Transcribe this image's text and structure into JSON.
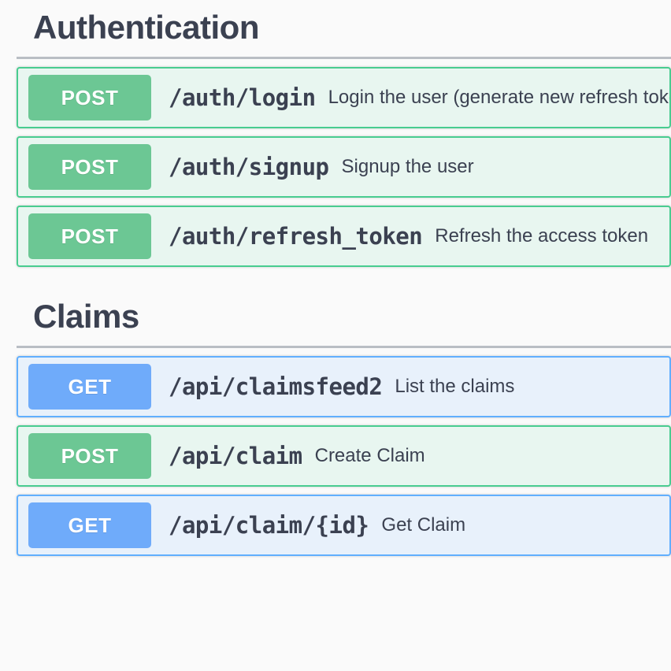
{
  "page": {
    "background": "#fafafa",
    "text_color": "#3b4151"
  },
  "colors": {
    "post_badge": "#6cc794",
    "post_row_bg": "#e8f6f0",
    "post_row_border": "#49cc90",
    "get_badge": "#6fabfa",
    "get_row_bg": "#e8f1fb",
    "get_row_border": "#61affe",
    "rule": "#b9bec4",
    "heading": "#3b4151"
  },
  "sections": [
    {
      "title": "Authentication",
      "operations": [
        {
          "method": "POST",
          "path": "/auth/login",
          "summary": "Login the user (generate new refresh token)"
        },
        {
          "method": "POST",
          "path": "/auth/signup",
          "summary": "Signup the user"
        },
        {
          "method": "POST",
          "path": "/auth/refresh_token",
          "summary": "Refresh the access token"
        }
      ]
    },
    {
      "title": "Claims",
      "operations": [
        {
          "method": "GET",
          "path": "/api/claimsfeed2",
          "summary": "List the claims"
        },
        {
          "method": "POST",
          "path": "/api/claim",
          "summary": "Create Claim"
        },
        {
          "method": "GET",
          "path": "/api/claim/{id}",
          "summary": "Get Claim"
        }
      ]
    }
  ]
}
